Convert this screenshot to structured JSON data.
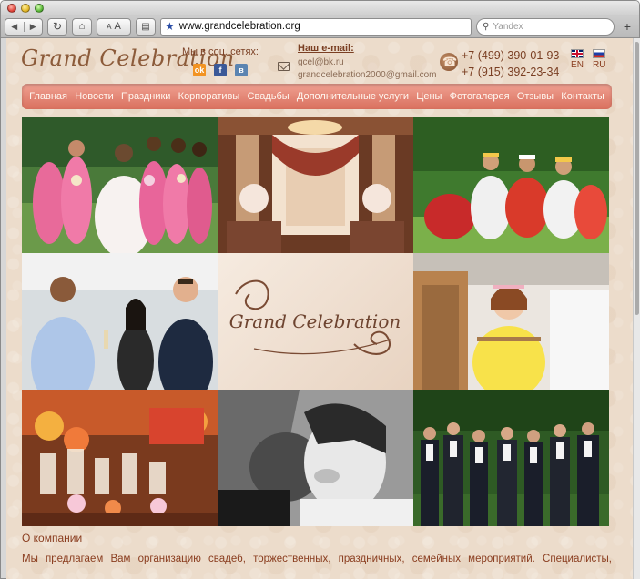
{
  "browser": {
    "url": "www.grandcelebration.org",
    "search_placeholder": "Yandex",
    "font_small_label": "A",
    "font_large_label": "A"
  },
  "header": {
    "logo_text": "Grand Celebration",
    "social_title": "Мы в соц. сетях:",
    "social_icons": [
      "odnoklassniki-icon",
      "facebook-icon",
      "vkontakte-icon"
    ],
    "email_title": "Наш e-mail:",
    "emails": [
      "gcel@bk.ru",
      "grandcelebration2000@gmail.com"
    ],
    "phones": [
      "+7 (499) 390-01-93",
      "+7 (915) 392-23-34"
    ],
    "languages": [
      "EN",
      "RU"
    ]
  },
  "nav": {
    "items": [
      "Главная",
      "Новости",
      "Праздники",
      "Корпоративы",
      "Свадьбы",
      "Дополнительные услуги",
      "Цены",
      "Фотогалерея",
      "Отзывы",
      "Контакты"
    ]
  },
  "gallery": {
    "center_logo_text": "Grand Celebration"
  },
  "about": {
    "title": "О компании",
    "text": "Мы предлагаем Вам организацию свадеб, торжественных, праздничных, семейных мероприятий. Специалисты,"
  },
  "colors": {
    "accent": "#d9705e",
    "text": "#8a3d1f",
    "background": "#ecdccb"
  }
}
